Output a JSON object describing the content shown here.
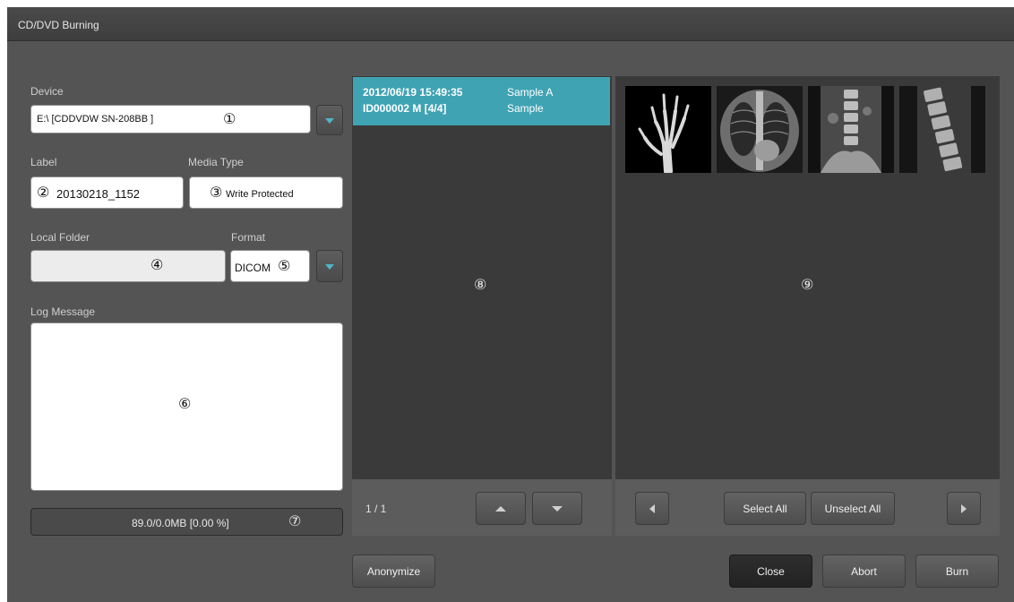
{
  "window": {
    "title": "CD/DVD Burning"
  },
  "device": {
    "label": "Device",
    "value": "E:\\ [CDDVDW SN-208BB ]",
    "marker": "①"
  },
  "label_field": {
    "label": "Label",
    "value": "20130218_1152",
    "marker": "②"
  },
  "media_type": {
    "label": "Media Type",
    "value": "Write Protected",
    "marker": "③"
  },
  "local_folder": {
    "label": "Local Folder",
    "value": "",
    "marker": "④"
  },
  "format": {
    "label": "Format",
    "value": "DICOM",
    "marker": "⑤"
  },
  "log": {
    "label": "Log Message",
    "marker": "⑥"
  },
  "progress": {
    "text": "89.0/0.0MB [0.00 %]",
    "marker": "⑦"
  },
  "study_list": {
    "marker": "⑧",
    "selected": {
      "datetime": "2012/06/19 15:49:35",
      "patient_id": "ID000002 M [4/4]",
      "name": "Sample A",
      "description": "Sample"
    },
    "page": "1 / 1"
  },
  "image_panel": {
    "marker": "⑨",
    "thumbnails": [
      "hand-xray",
      "chest-xray",
      "abdomen-xray",
      "spine-lateral-xray"
    ],
    "select_all": "Select All",
    "unselect_all": "Unselect All"
  },
  "buttons": {
    "anonymize": "Anonymize",
    "close": "Close",
    "abort": "Abort",
    "burn": "Burn"
  },
  "colors": {
    "accent": "#3fa3b4",
    "window_bg": "#545454",
    "panel_bg": "#3a3a3a"
  }
}
